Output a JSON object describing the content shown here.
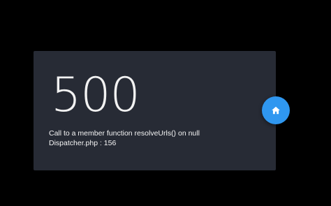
{
  "error": {
    "code": "500",
    "message": "Call to a member function resolveUrls() on null",
    "location": "Dispatcher.php : 156"
  },
  "actions": {
    "home_icon": "home-icon"
  },
  "colors": {
    "background": "#000000",
    "card": "#272b35",
    "text": "#f2f2f2",
    "accent": "#2f97f0"
  }
}
